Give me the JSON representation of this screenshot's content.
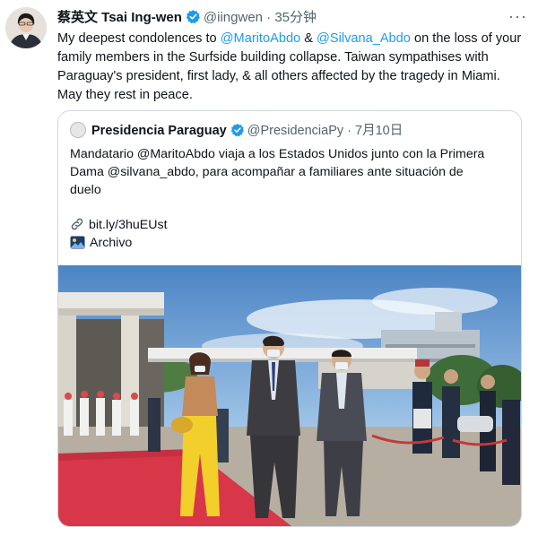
{
  "tweet": {
    "author_name": "蔡英文 Tsai Ing-wen",
    "handle": "@iingwen",
    "separator": "·",
    "time": "35分钟",
    "more_label": "···",
    "text_parts": {
      "p1": "My deepest condolences to ",
      "m1": "@MaritoAbdo",
      "p2": " & ",
      "m2": "@Silvana_Abdo",
      "p3": " on the loss of your family members in the Surfside building collapse. Taiwan sympathises with Paraguay's president, first lady, & all others affected by the tragedy in Miami. May they rest in peace."
    }
  },
  "quoted": {
    "author_name": "Presidencia Paraguay",
    "handle": "@PresidenciaPy",
    "separator": "·",
    "date": "7月10日",
    "text": "Mandatario @MaritoAbdo viaja a los Estados Unidos junto con la Primera Dama @silvana_abdo, para acompañar a familiares ante situación de duelo",
    "link": "bit.ly/3huEUst",
    "archive_label": "Archivo"
  },
  "icons": {
    "verified": "verified-badge-icon",
    "link": "link-icon",
    "archive": "archive-image-icon",
    "more": "more-options-icon"
  },
  "colors": {
    "accent": "#1d9bf0",
    "text": "#0f1419",
    "muted": "#536471",
    "border": "#cfd9de"
  }
}
